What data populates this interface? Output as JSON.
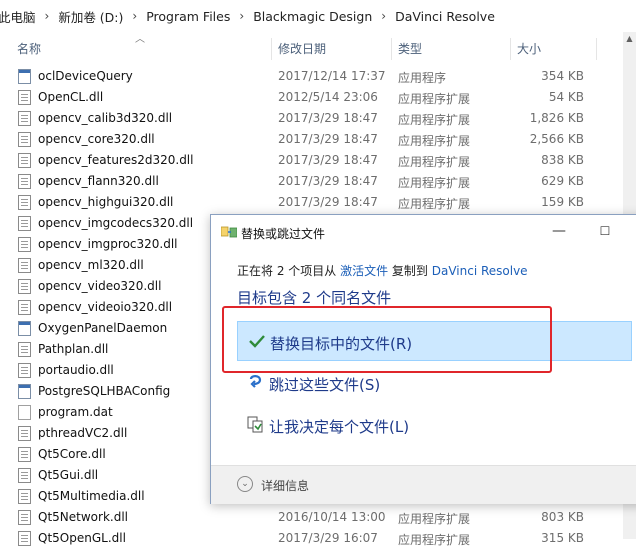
{
  "breadcrumb": [
    "此电脑",
    "新加卷 (D:)",
    "Program Files",
    "Blackmagic Design",
    "DaVinci Resolve"
  ],
  "columns": {
    "name": "名称",
    "date": "修改日期",
    "type": "类型",
    "size": "大小"
  },
  "files": [
    {
      "name": "oclDeviceQuery",
      "date": "2017/12/14 17:37",
      "type": "应用程序",
      "size": "354 KB",
      "icon": "exe-icon"
    },
    {
      "name": "OpenCL.dll",
      "date": "2012/5/14 23:06",
      "type": "应用程序扩展",
      "size": "54 KB",
      "icon": "dll-icon"
    },
    {
      "name": "opencv_calib3d320.dll",
      "date": "2017/3/29 18:47",
      "type": "应用程序扩展",
      "size": "1,826 KB",
      "icon": "dll-icon"
    },
    {
      "name": "opencv_core320.dll",
      "date": "2017/3/29 18:47",
      "type": "应用程序扩展",
      "size": "2,566 KB",
      "icon": "dll-icon"
    },
    {
      "name": "opencv_features2d320.dll",
      "date": "2017/3/29 18:47",
      "type": "应用程序扩展",
      "size": "838 KB",
      "icon": "dll-icon"
    },
    {
      "name": "opencv_flann320.dll",
      "date": "2017/3/29 18:47",
      "type": "应用程序扩展",
      "size": "629 KB",
      "icon": "dll-icon"
    },
    {
      "name": "opencv_highgui320.dll",
      "date": "2017/3/29 18:47",
      "type": "应用程序扩展",
      "size": "159 KB",
      "icon": "dll-icon"
    },
    {
      "name": "opencv_imgcodecs320.dll",
      "date": "",
      "type": "",
      "size": "",
      "icon": "dll-icon"
    },
    {
      "name": "opencv_imgproc320.dll",
      "date": "",
      "type": "",
      "size": "",
      "icon": "dll-icon"
    },
    {
      "name": "opencv_ml320.dll",
      "date": "",
      "type": "",
      "size": "",
      "icon": "dll-icon"
    },
    {
      "name": "opencv_video320.dll",
      "date": "",
      "type": "",
      "size": "",
      "icon": "dll-icon"
    },
    {
      "name": "opencv_videoio320.dll",
      "date": "",
      "type": "",
      "size": "",
      "icon": "dll-icon"
    },
    {
      "name": "OxygenPanelDaemon",
      "date": "",
      "type": "",
      "size": "",
      "icon": "exe-icon"
    },
    {
      "name": "Pathplan.dll",
      "date": "",
      "type": "",
      "size": "",
      "icon": "dll-icon"
    },
    {
      "name": "portaudio.dll",
      "date": "",
      "type": "",
      "size": "",
      "icon": "dll-icon"
    },
    {
      "name": "PostgreSQLHBAConfig",
      "date": "",
      "type": "",
      "size": "",
      "icon": "exe-icon"
    },
    {
      "name": "program.dat",
      "date": "",
      "type": "",
      "size": "",
      "icon": "dat-icon"
    },
    {
      "name": "pthreadVC2.dll",
      "date": "",
      "type": "",
      "size": "",
      "icon": "dll-icon"
    },
    {
      "name": "Qt5Core.dll",
      "date": "",
      "type": "",
      "size": "",
      "icon": "dll-icon"
    },
    {
      "name": "Qt5Gui.dll",
      "date": "",
      "type": "",
      "size": "",
      "icon": "dll-icon"
    },
    {
      "name": "Qt5Multimedia.dll",
      "date": "",
      "type": "",
      "size": "",
      "icon": "dll-icon"
    },
    {
      "name": "Qt5Network.dll",
      "date": "2016/10/14 13:00",
      "type": "应用程序扩展",
      "size": "803 KB",
      "icon": "dll-icon"
    },
    {
      "name": "Qt5OpenGL.dll",
      "date": "2017/3/29 16:07",
      "type": "应用程序扩展",
      "size": "315 KB",
      "icon": "dll-icon"
    }
  ],
  "dialog": {
    "title": "替换或跳过文件",
    "desc_prefix": "正在将 2 个项目从 ",
    "desc_source": "激活文件",
    "desc_mid": " 复制到 ",
    "desc_dest": "DaVinci Resolve",
    "headline": "目标包含 2 个同名文件",
    "option_replace": "替换目标中的文件(R)",
    "option_skip": "跳过这些文件(S)",
    "option_decide": "让我决定每个文件(L)",
    "details": "详细信息",
    "min_glyph": "—",
    "max_glyph": "☐",
    "close_glyph": "✕"
  },
  "colors": {
    "accent": "#1e3a8a",
    "link": "#1c5fb8",
    "selection": "#cce8ff",
    "highlight_box": "#e0262b"
  }
}
